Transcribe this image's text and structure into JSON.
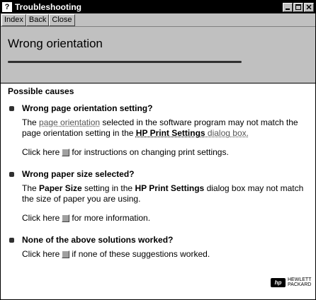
{
  "window": {
    "title": "Troubleshooting"
  },
  "toolbar": {
    "index_label": "Index",
    "back_label": "Back",
    "close_label": "Close"
  },
  "header": {
    "title": "Wrong orientation"
  },
  "content": {
    "section_heading": "Possible causes",
    "causes": [
      {
        "title": "Wrong page orientation setting?",
        "desc_pre": "The ",
        "desc_link": "page orientation",
        "desc_mid": " selected in the software program may not match the page orientation setting in the ",
        "desc_bold": "HP Print Settings",
        "desc_post": " dialog box.",
        "action_pre": "Click here",
        "action_post": "for instructions on changing print settings."
      },
      {
        "title": "Wrong paper size selected?",
        "desc_pre": "The ",
        "desc_bold1": "Paper Size",
        "desc_mid": " setting in the ",
        "desc_bold2": "HP Print Settings",
        "desc_post": " dialog box may not match the size of paper you are using.",
        "action_pre": "Click here",
        "action_post": "for more information."
      },
      {
        "title": "None of the above solutions worked?",
        "action_pre": "Click here",
        "action_post": "if none of these suggestions worked."
      }
    ]
  },
  "logo": {
    "badge": "hp",
    "line1": "HEWLETT",
    "line2": "PACKARD"
  }
}
